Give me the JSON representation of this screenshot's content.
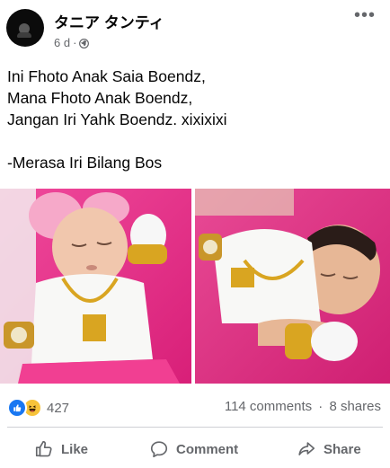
{
  "post": {
    "author": "タニア タンティ",
    "time": "6 d",
    "separator": "·",
    "text_lines": [
      "Ini Fhoto Anak Saia Boendz,",
      "Mana Fhoto Anak Boendz,",
      "Jangan Iri Yahk Boendz. xixixixi",
      "",
      "-Merasa Iri Bilang Bos"
    ],
    "photos": [
      {
        "icon": "baby-photo-left"
      },
      {
        "icon": "baby-photo-right"
      }
    ]
  },
  "footer": {
    "reaction_count": "427",
    "reaction_icons": [
      "like-icon",
      "haha-icon"
    ],
    "comments": "114 comments",
    "dot": "·",
    "shares": "8 shares"
  },
  "actions": {
    "like": "Like",
    "comment": "Comment",
    "share": "Share"
  },
  "colors": {
    "accent": "#1877f2",
    "secondary_text": "#65676b",
    "blanket_pink": "#e6308a"
  }
}
